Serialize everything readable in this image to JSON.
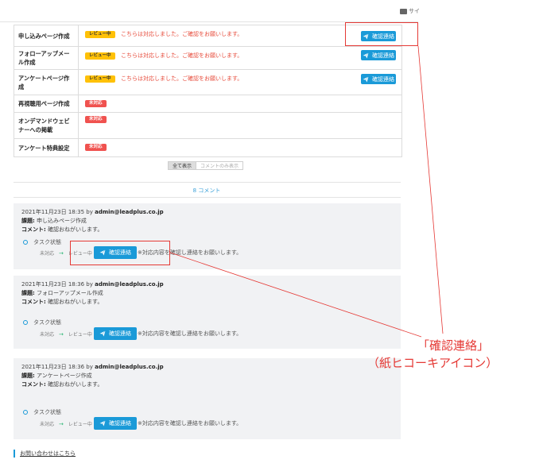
{
  "header": {
    "menu_label": "サイ"
  },
  "tasks": [
    {
      "name": "申し込みページ作成",
      "status": "レビュー中",
      "message": "こちらは対応しました。ご確認をお願いします。",
      "button": "確認連絡"
    },
    {
      "name": "フォローアップメール作成",
      "status": "レビュー中",
      "message": "こちらは対応しました。ご確認をお願いします。",
      "button": "確認連絡"
    },
    {
      "name": "アンケートページ作成",
      "status": "レビュー中",
      "message": "こちらは対応しました。ご確認をお願いします。",
      "button": "確認連絡"
    },
    {
      "name": "再視聴用ページ作成",
      "status": "未対応"
    },
    {
      "name": "オンデマンドウェビナーへの掲載",
      "status": "未対応"
    },
    {
      "name": "アンケート特典設定",
      "status": "未対応"
    }
  ],
  "filter": {
    "all": "全て表示",
    "comments_only": "コメントのみ表示"
  },
  "comments_count": "8 コメント",
  "comments": [
    {
      "date": "2021年11月23日 18:35",
      "by": "by",
      "author": "admin@leadplus.co.jp",
      "subject_label": "課題:",
      "subject": "申し込みページ作成",
      "comment_label": "コメント:",
      "comment": "確認おねがいします。",
      "status_title": "タスク状態",
      "from": "未対応",
      "to": "レビュー中",
      "button": "確認連絡",
      "note": "※対応内容を確認し連絡をお願いします。"
    },
    {
      "date": "2021年11月23日 18:36",
      "by": "by",
      "author": "admin@leadplus.co.jp",
      "subject_label": "課題:",
      "subject": "フォローアップメール作成",
      "comment_label": "コメント:",
      "comment": "確認おねがいします。",
      "status_title": "タスク状態",
      "from": "未対応",
      "to": "レビュー中",
      "button": "確認連絡",
      "note": "※対応内容を確認し連絡をお願いします。"
    },
    {
      "date": "2021年11月23日 18:36",
      "by": "by",
      "author": "admin@leadplus.co.jp",
      "subject_label": "課題:",
      "subject": "アンケートページ作成",
      "comment_label": "コメント:",
      "comment": "確認おねがいします。",
      "status_title": "タスク状態",
      "from": "未対応",
      "to": "レビュー中",
      "button": "確認連絡",
      "note": "※対応内容を確認し連絡をお願いします。"
    }
  ],
  "annotation": {
    "line1": "「確認連絡」",
    "line2": "（紙ヒコーキアイコン）"
  },
  "footer": {
    "contact_link": "お問い合わせはこちら"
  },
  "colors": {
    "accent": "#1a9ad8",
    "review_badge": "#ffc107",
    "todo_badge": "#f0524f",
    "annotation": "#e53935"
  },
  "icons": {
    "send": "paper-plane-icon",
    "menu": "briefcase-icon"
  }
}
